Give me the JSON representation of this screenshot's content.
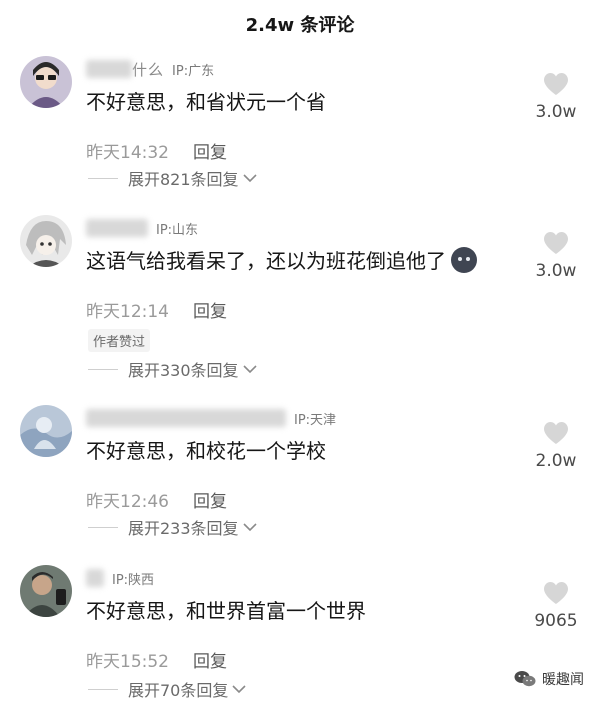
{
  "header": {
    "title": "2.4w 条评论"
  },
  "comments": [
    {
      "username": "什么",
      "ip": "IP:广东",
      "text": "不好意思，和省状元一个省",
      "time": "昨天14:32",
      "reply": "回复",
      "expand": "展开821条回复",
      "likes": "3.0w"
    },
    {
      "username": "",
      "ip": "IP:山东",
      "text": "这语气给我看呆了，还以为班花倒追他了",
      "time": "昨天12:14",
      "reply": "回复",
      "author_liked": "作者赞过",
      "expand": "展开330条回复",
      "likes": "3.0w"
    },
    {
      "username": "",
      "ip": "IP:天津",
      "text": "不好意思，和校花一个学校",
      "time": "昨天12:46",
      "reply": "回复",
      "expand": "展开233条回复",
      "likes": "2.0w"
    },
    {
      "username": "",
      "ip": "IP:陕西",
      "text": "不好意思，和世界首富一个世界",
      "time": "昨天15:52",
      "reply": "回复",
      "expand": "展开70条回复",
      "likes": "9065"
    }
  ],
  "watermark": {
    "text": "暖趣闻"
  },
  "colors": {
    "text": "#161616",
    "muted": "#9a9a9a",
    "heart": "#d6d6d6"
  }
}
